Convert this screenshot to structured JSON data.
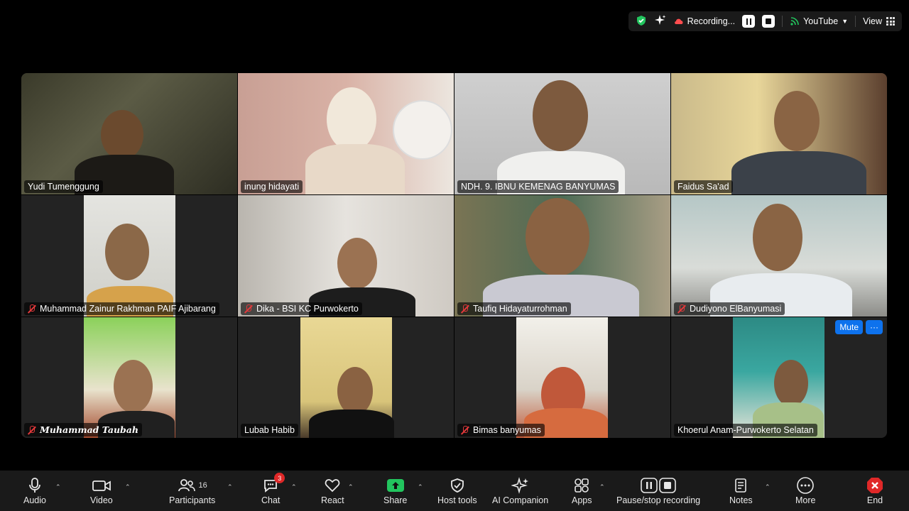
{
  "top_bar": {
    "recording_label": "Recording...",
    "stream_label": "YouTube",
    "view_label": "View"
  },
  "tiles": [
    {
      "name": "Yudi Tumenggung",
      "muted": false
    },
    {
      "name": "inung hidayati",
      "muted": false,
      "active": true
    },
    {
      "name": "NDH. 9. IBNU KEMENAG BANYUMAS",
      "muted": false
    },
    {
      "name": "Faidus Sa'ad",
      "muted": false
    },
    {
      "name": "Muhammad Zainur Rakhman PAIF Ajibarang",
      "muted": true
    },
    {
      "name": "Dika - BSI KC Purwokerto",
      "muted": true
    },
    {
      "name": "Taufiq Hidayaturrohman",
      "muted": true
    },
    {
      "name": "Dudiyono ElBanyumasi",
      "muted": true
    },
    {
      "name": "Muhammad Taubah",
      "muted": true
    },
    {
      "name": "Lubab Habib",
      "muted": false
    },
    {
      "name": "Bimas banyumas",
      "muted": true
    },
    {
      "name": "Khoerul Anam-Purwokerto Selatan",
      "muted": false
    }
  ],
  "tile_controls": {
    "mute_label": "Mute",
    "more_label": "···"
  },
  "toolbar": {
    "audio": "Audio",
    "video": "Video",
    "participants": "Participants",
    "participants_count": "16",
    "chat": "Chat",
    "chat_badge": "3",
    "react": "React",
    "share": "Share",
    "host_tools": "Host tools",
    "ai_companion": "AI Companion",
    "apps": "Apps",
    "pause_stop": "Pause/stop recording",
    "notes": "Notes",
    "more": "More",
    "end": "End"
  },
  "colors": {
    "active_speaker": "#3ddc84",
    "share": "#22c55e",
    "end": "#e02828",
    "accent": "#0e72ed"
  }
}
